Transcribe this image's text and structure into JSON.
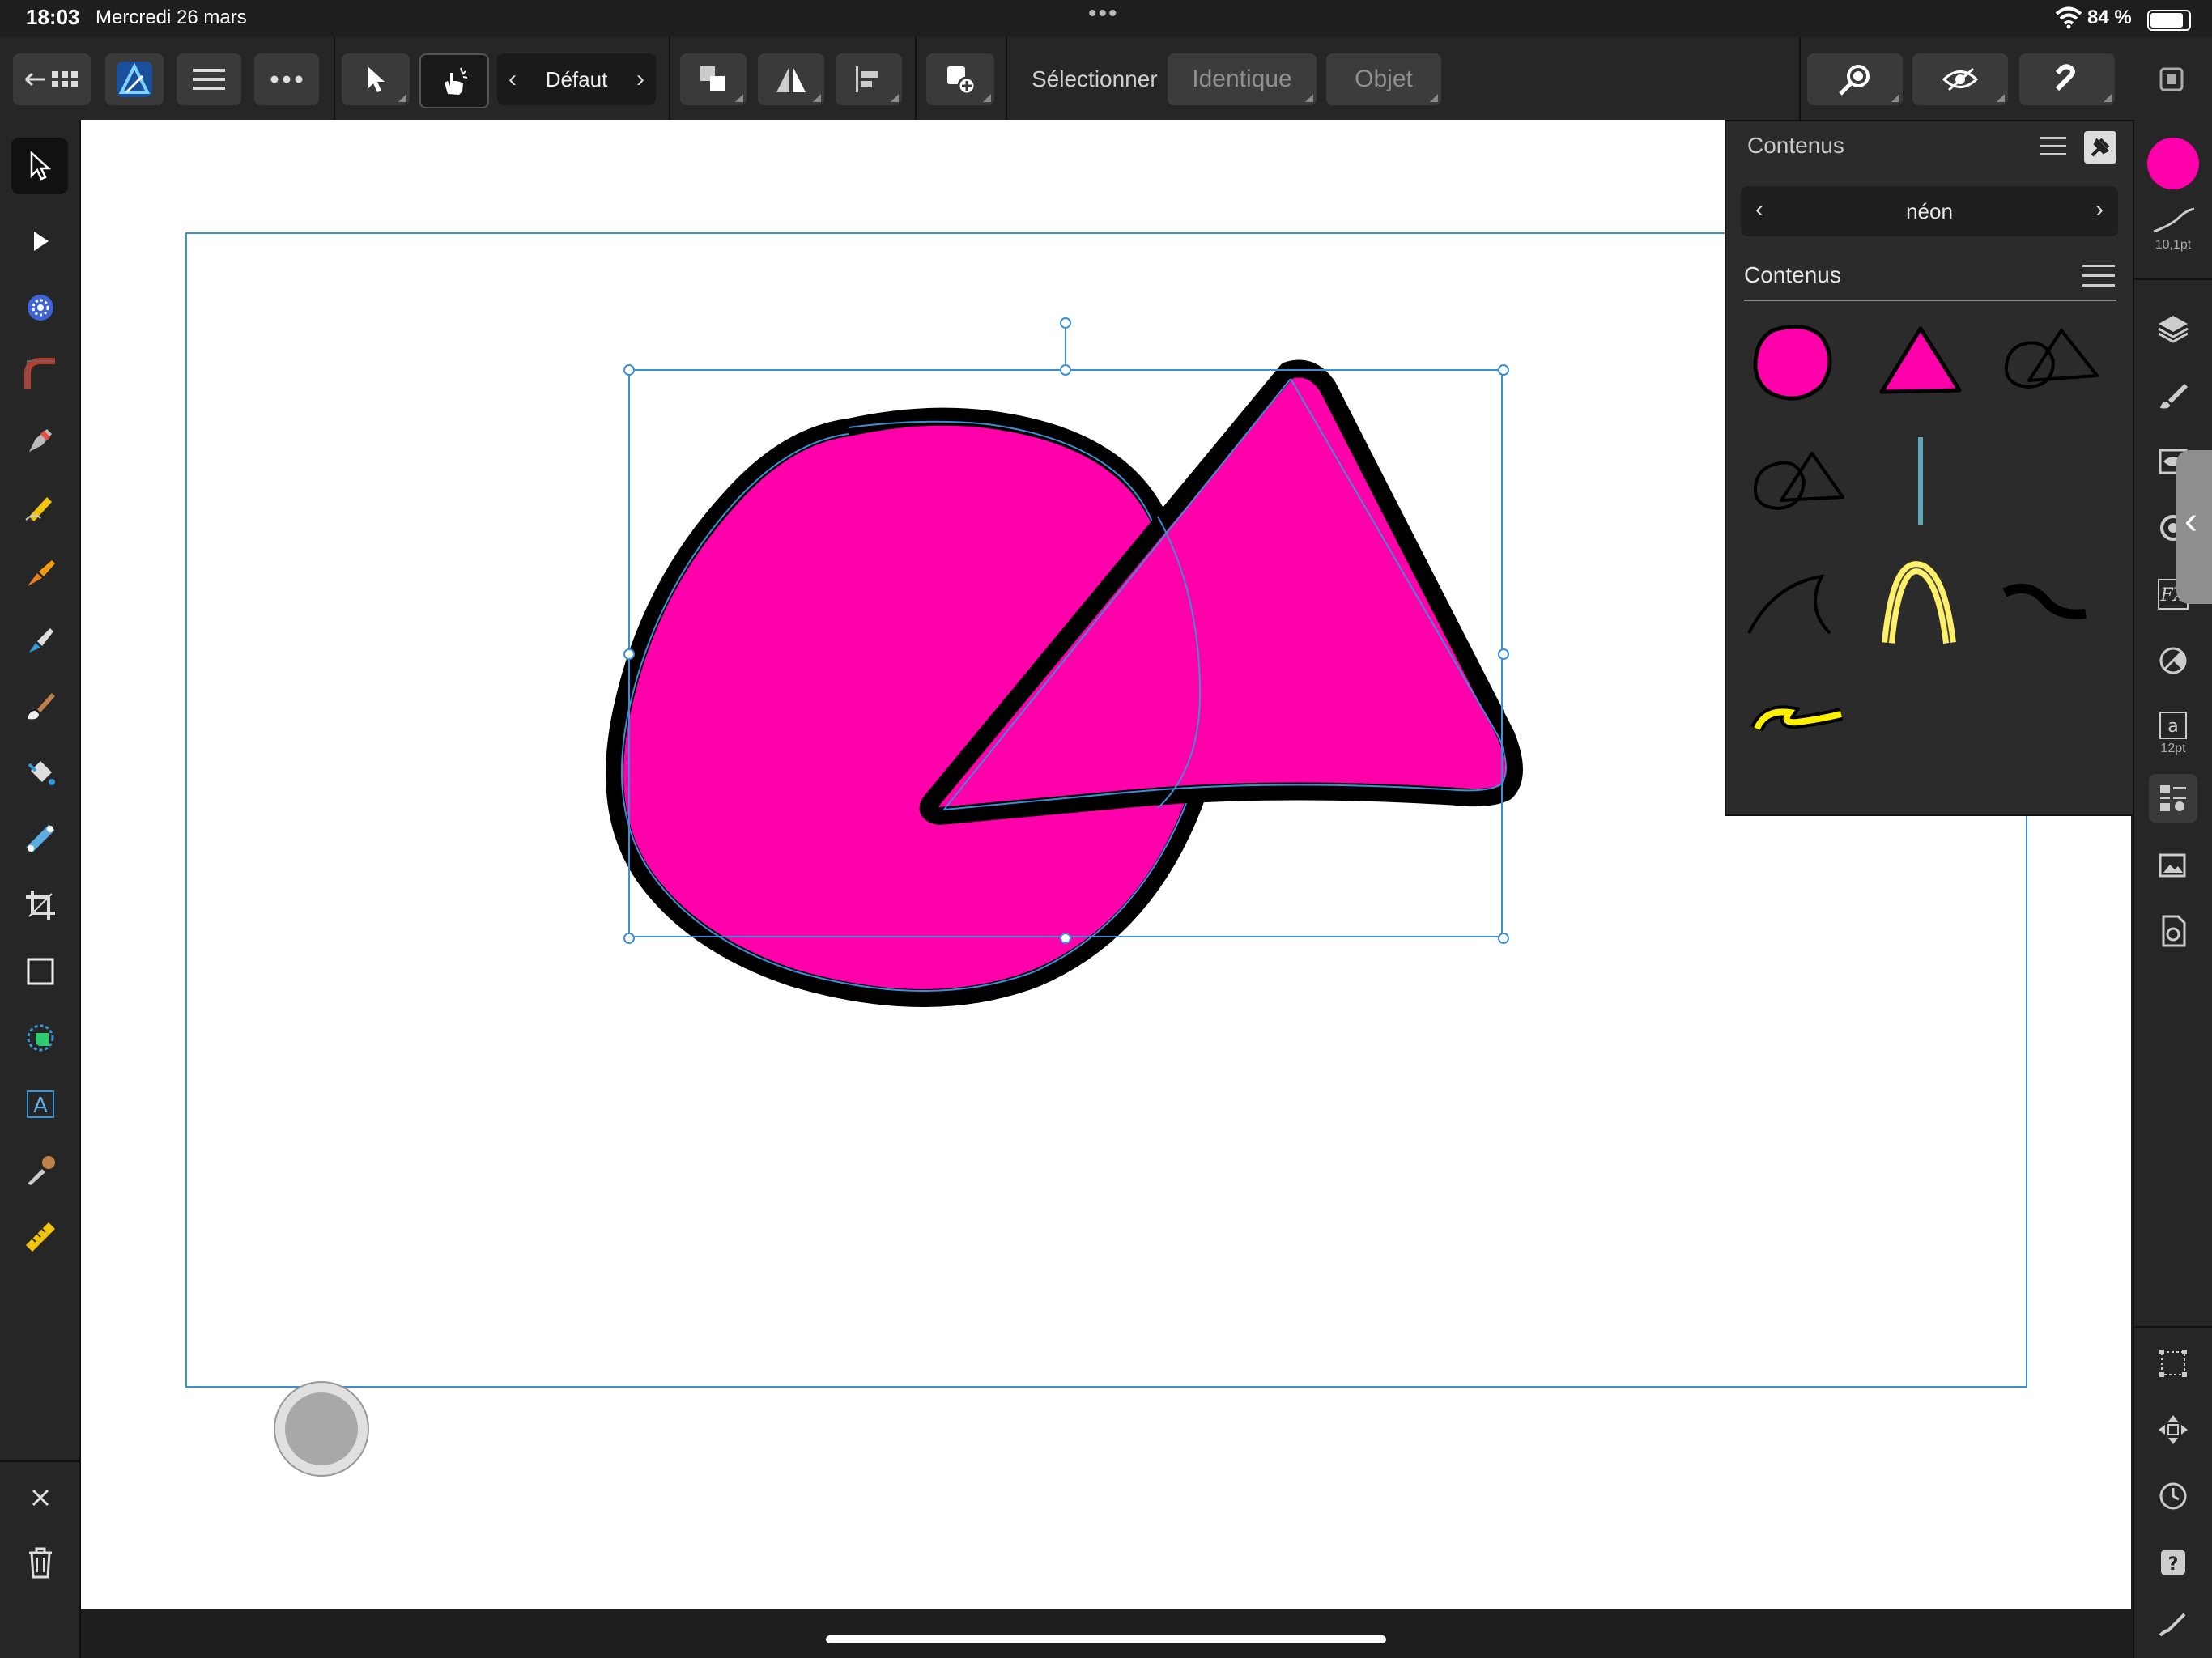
{
  "status_bar": {
    "time": "18:03",
    "date": "Mercredi 26 mars",
    "battery": "84 %"
  },
  "toolbar": {
    "style_preset": "Défaut",
    "select_label": "Sélectionner",
    "same_label": "Identique",
    "object_label": "Objet"
  },
  "panel": {
    "title": "Contenus",
    "category": "néon",
    "section_title": "Contenus",
    "thumbnails": [
      "pink-circle",
      "pink-triangle",
      "circle-triangle-outline",
      "circle-triangle-outline-2",
      "blue-line",
      "black-curve",
      "yellow-arch",
      "black-squiggle",
      "yellow-squiggle"
    ]
  },
  "right_panel": {
    "fill_color": "#ff00aa",
    "stroke_width": "10,1pt",
    "text_size": "12pt"
  },
  "colors": {
    "accent_pink": "#ff00aa",
    "selection_blue": "#3b8fd6",
    "stroke_black": "#000000"
  }
}
